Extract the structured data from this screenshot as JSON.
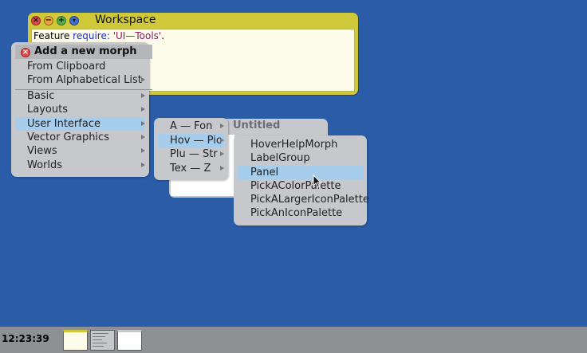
{
  "workspace": {
    "title": "Workspace",
    "code": {
      "prefix": "Feature ",
      "keyword": "require:",
      "space": " ",
      "string": "'UI—Tools'",
      "suffix": "."
    }
  },
  "untitled_window": {
    "title": "Untitled"
  },
  "new_morph_menu": {
    "title": "Add a new morph",
    "top_items": [
      {
        "label": "From Clipboard",
        "has_submenu": false
      },
      {
        "label": "From Alphabetical List",
        "has_submenu": true
      }
    ],
    "category_items": [
      {
        "label": "Basic",
        "has_submenu": true,
        "selected": false
      },
      {
        "label": "Layouts",
        "has_submenu": true,
        "selected": false
      },
      {
        "label": "User Interface",
        "has_submenu": true,
        "selected": true
      },
      {
        "label": "Vector Graphics",
        "has_submenu": true,
        "selected": false
      },
      {
        "label": "Views",
        "has_submenu": true,
        "selected": false
      },
      {
        "label": "Worlds",
        "has_submenu": true,
        "selected": false
      }
    ]
  },
  "range_menu": {
    "items": [
      {
        "label": "A — Fon",
        "selected": false
      },
      {
        "label": "Hov — Pic",
        "selected": true
      },
      {
        "label": "Plu — Str",
        "selected": false
      },
      {
        "label": "Tex — Z",
        "selected": false
      }
    ]
  },
  "morph_menu": {
    "items": [
      {
        "label": "HoverHelpMorph",
        "selected": false
      },
      {
        "label": "LabelGroup",
        "selected": false
      },
      {
        "label": "Panel",
        "selected": true
      },
      {
        "label": "PickAColorPalette",
        "selected": false
      },
      {
        "label": "PickALargerIconPalette",
        "selected": false
      },
      {
        "label": "PickAnIconPalette",
        "selected": false
      }
    ]
  },
  "taskbar": {
    "clock": "12:23:39"
  },
  "colors": {
    "desktop": "#2a5ca8",
    "workspace_title": "#cfc93a",
    "menu_bg": "#c7c8cc",
    "selection": "#a6cdeb",
    "close_button": "#e04848",
    "minimize_button": "#e8a33a",
    "expand_button": "#58b04a",
    "collapse_button": "#3f6fd0"
  },
  "icons": {
    "close": "close-icon",
    "minimize": "minimize-icon",
    "expand": "expand-icon",
    "collapse": "collapse-icon",
    "submenu": "submenu-arrow-icon",
    "cursor": "mouse-pointer-icon"
  }
}
